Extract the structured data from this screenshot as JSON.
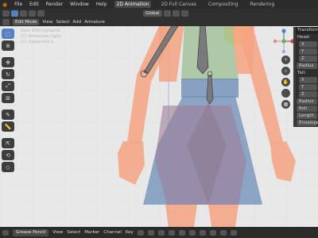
{
  "topbar": {
    "menus": [
      "File",
      "Edit",
      "Render",
      "Window",
      "Help"
    ],
    "workspaces": [
      "2D Animation",
      "2D Full Canvas",
      "Compositing",
      "Rendering"
    ],
    "active_workspace": "2D Animation"
  },
  "toolbar2": {
    "orientation": "Global"
  },
  "header3": {
    "mode": "Edit Mode",
    "menus": [
      "View",
      "Select",
      "Add",
      "Armature"
    ]
  },
  "viewport": {
    "overlay_lines": [
      "User Orthographic",
      "(1) Armature.rigify",
      "(1) Upperarm.L"
    ],
    "view_buttons": [
      "+",
      "⌕",
      "✋",
      "🎥",
      "▦"
    ]
  },
  "npanel": {
    "title": "Transform",
    "head_label": "Head:",
    "tail_label": "Tail:",
    "axes": [
      "X",
      "Y",
      "Z"
    ],
    "radius_label": "Radius",
    "roll_label": "Roll",
    "length_label": "Length",
    "envelope_label": "Envelope"
  },
  "bottom": {
    "editor": "Grease Pencil",
    "menus": [
      "View",
      "Select",
      "Marker",
      "Channel",
      "Key"
    ]
  },
  "colors": {
    "skin": "#f4a383",
    "dress": "#6f8fb8",
    "top": "#9fbf97",
    "hair": "#f2d24a",
    "accent": "#5680c2"
  }
}
